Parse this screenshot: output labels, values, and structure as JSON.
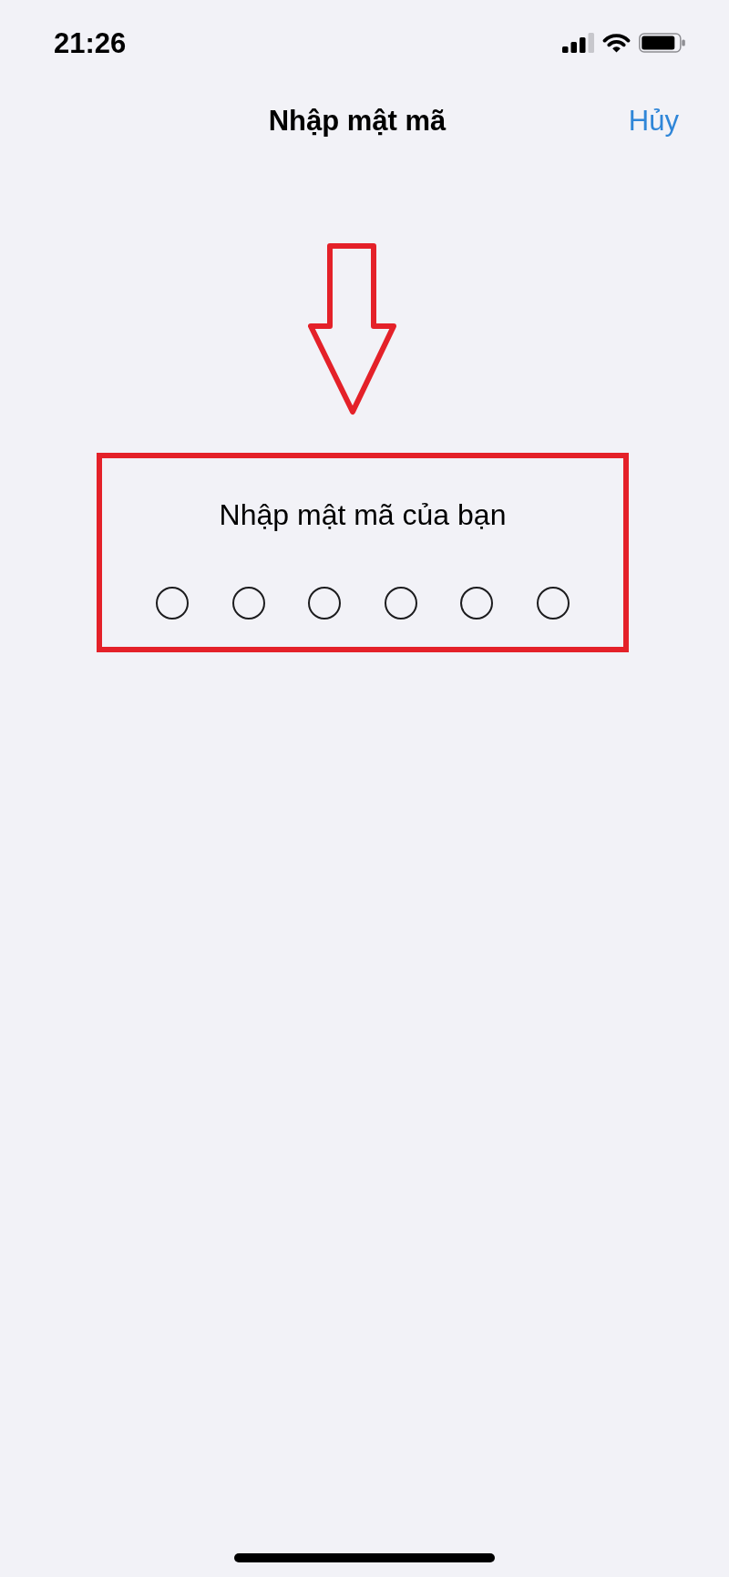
{
  "status_bar": {
    "time": "21:26"
  },
  "nav_bar": {
    "title": "Nhập mật mã",
    "cancel_button": "Hủy"
  },
  "passcode": {
    "prompt": "Nhập mật mã của bạn",
    "digits": [
      {
        "filled": false
      },
      {
        "filled": false
      },
      {
        "filled": false
      },
      {
        "filled": false
      },
      {
        "filled": false
      },
      {
        "filled": false
      }
    ]
  }
}
